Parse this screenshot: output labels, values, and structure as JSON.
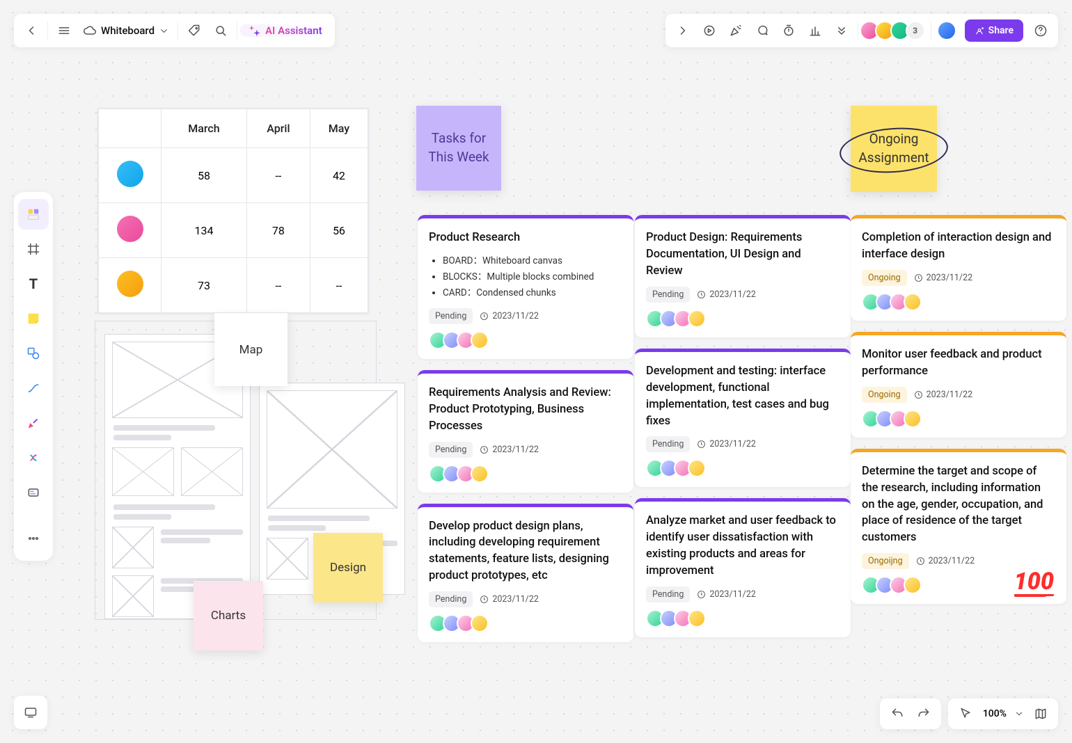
{
  "board_name": "Whiteboard",
  "ai_label": "AI Assistant",
  "share_label": "Share",
  "avatars_more": "3",
  "zoom": "100%",
  "table": {
    "headers": [
      "",
      "March",
      "April",
      "May"
    ],
    "rows": [
      {
        "avatar": "rv1",
        "cells": [
          "58",
          "--",
          "42"
        ]
      },
      {
        "avatar": "rv2",
        "cells": [
          "134",
          "78",
          "56"
        ]
      },
      {
        "avatar": "rv3",
        "cells": [
          "73",
          "--",
          "--"
        ]
      }
    ]
  },
  "stickies": {
    "map": "Map",
    "design": "Design",
    "charts": "Charts",
    "tasks_header": "Tasks for\nThis Week",
    "ongoing_header": "Ongoing\nAssignment"
  },
  "columns": {
    "c1": [
      {
        "title": "Product Research",
        "bullets": [
          "BOARD：Whiteboard canvas",
          "BLOCKS：Multiple blocks combined",
          "CARD：Condensed chunks"
        ],
        "tag": "Pending",
        "tag_style": "",
        "date": "2023/11/22"
      },
      {
        "title": "Requirements Analysis and Review: Product Prototyping, Business Processes",
        "tag": "Pending",
        "tag_style": "",
        "date": "2023/11/22"
      },
      {
        "title": "Develop product design plans, including developing requirement statements, feature lists, designing product prototypes, etc",
        "tag": "Pending",
        "tag_style": "",
        "date": "2023/11/22"
      }
    ],
    "c2": [
      {
        "title": "Product Design: Requirements Documentation, UI Design and Review",
        "tag": "Pending",
        "tag_style": "",
        "date": "2023/11/22"
      },
      {
        "title": "Development and testing: interface development, functional implementation, test cases and bug fixes",
        "tag": "Pending",
        "tag_style": "",
        "date": "2023/11/22"
      },
      {
        "title": "Analyze market and user feedback to identify user dissatisfaction with existing products and areas for improvement",
        "tag": "Pending",
        "tag_style": "",
        "date": "2023/11/22"
      }
    ],
    "c3": [
      {
        "title": "Completion of interaction design and interface design",
        "tag": "Ongoing",
        "tag_style": "orange",
        "date": "2023/11/22"
      },
      {
        "title": "Monitor user feedback and product performance",
        "tag": "Ongoing",
        "tag_style": "orange",
        "date": "2023/11/22"
      },
      {
        "title": "Determine the target and scope of the research, including information on the age, gender, occupation, and place of residence of the target customers",
        "tag": "Ongoijng",
        "tag_style": "orange",
        "date": "2023/11/22",
        "hundred": true
      }
    ]
  }
}
